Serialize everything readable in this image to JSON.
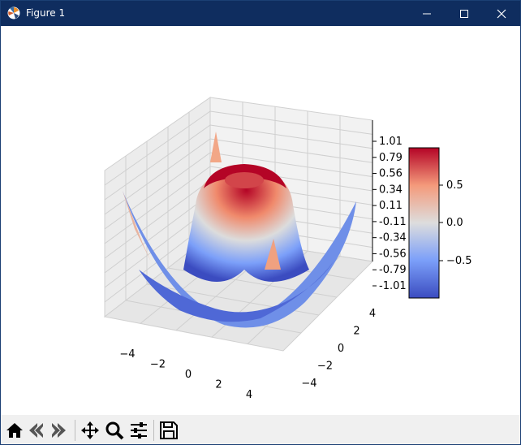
{
  "window": {
    "title": "Figure 1"
  },
  "chart_data": {
    "type": "surface3d",
    "colormap": "coolwarm",
    "z_ticks": [
      "1.01",
      "0.79",
      "0.56",
      "0.34",
      "0.11",
      "-0.11",
      "-0.34",
      "-0.56",
      "-0.79",
      "-1.01"
    ],
    "x_ticks": [
      "−4",
      "−2",
      "0",
      "2",
      "4"
    ],
    "y_ticks": [
      "−4",
      "−2",
      "0",
      "2",
      "4"
    ],
    "colorbar_ticks": [
      "0.5",
      "0.0",
      "−0.5"
    ],
    "xlim": [
      -5,
      5
    ],
    "ylim": [
      -5,
      5
    ],
    "zlim": [
      -1.01,
      1.01
    ],
    "grid": true
  },
  "toolbar": {
    "buttons": [
      {
        "icon": "home-icon"
      },
      {
        "icon": "back-arrow-icon"
      },
      {
        "icon": "forward-arrow-icon"
      },
      {
        "icon": "pan-arrows-icon"
      },
      {
        "icon": "zoom-magnifier-icon"
      },
      {
        "icon": "configure-subplots-icon"
      },
      {
        "icon": "save-disk-icon"
      }
    ]
  }
}
